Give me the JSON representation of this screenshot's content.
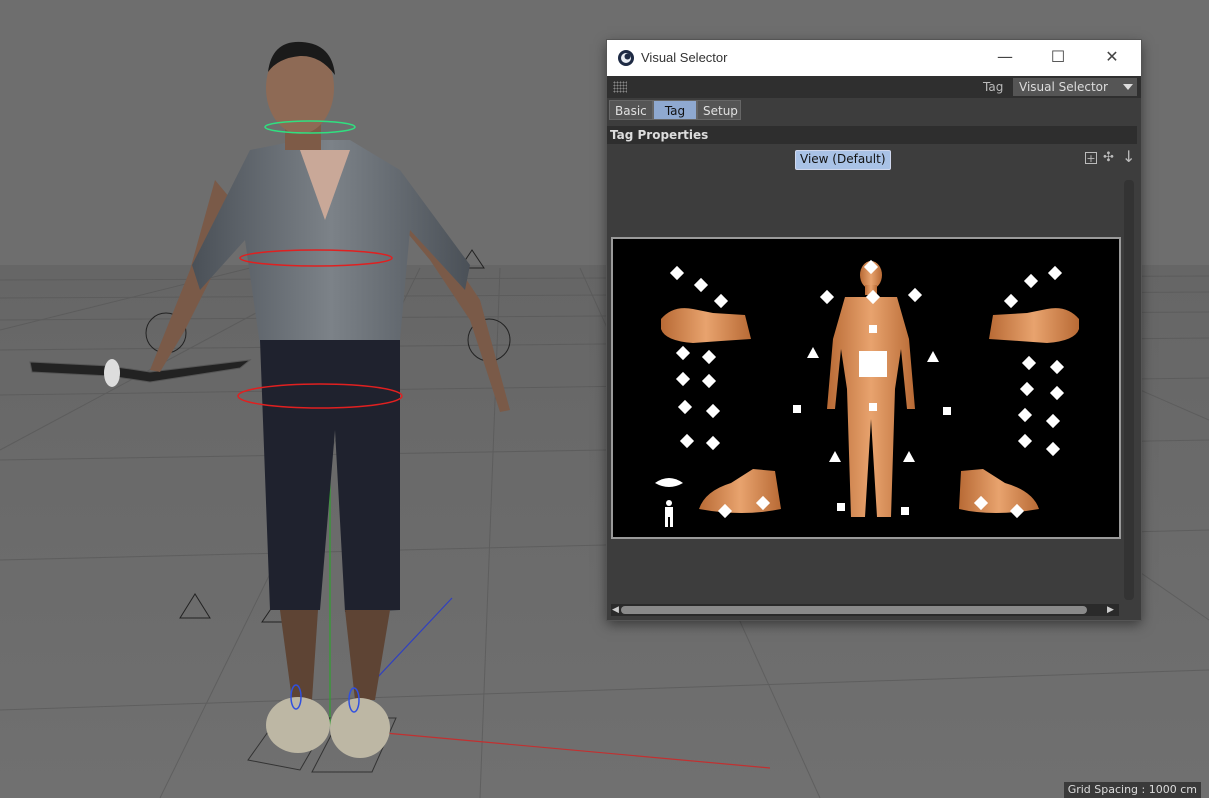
{
  "window": {
    "title": "Visual Selector",
    "minimize_glyph": "—",
    "maximize_glyph": "☐",
    "close_glyph": "✕"
  },
  "toolbar": {
    "tag_label": "Tag",
    "tag_select_value": "Visual Selector"
  },
  "tabs": [
    {
      "label": "Basic",
      "active": false
    },
    {
      "label": "Tag",
      "active": true
    },
    {
      "label": "Setup",
      "active": false
    }
  ],
  "section": {
    "header": "Tag Properties",
    "view_button": "View (Default)"
  },
  "status": {
    "grid_spacing": "Grid Spacing : 1000 cm"
  },
  "icons": {
    "app": "cinema4d-icon",
    "grip": "grip-icon",
    "add": "add-icon",
    "move": "move-icon",
    "arrow": "arrow-down-icon"
  },
  "colors": {
    "viewport_bg": "#6c6c6c",
    "tab_active": "#8fa9d0",
    "view_button": "#a9c2e6",
    "selector_bg": "#000000",
    "skin": "#d48a55",
    "handle": "#ffffff"
  }
}
